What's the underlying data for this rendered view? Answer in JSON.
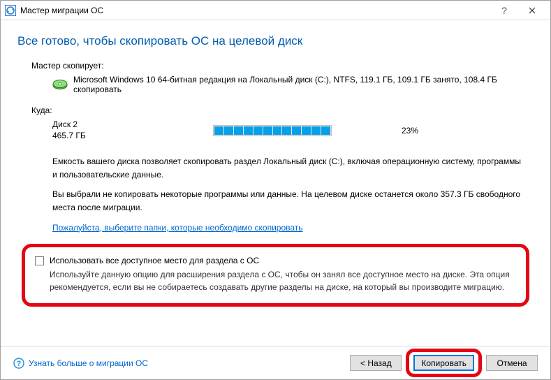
{
  "window": {
    "title": "Мастер миграции ОС"
  },
  "heading": "Все готово, чтобы скопировать ОС на целевой диск",
  "wizard_copies_label": "Мастер скопирует:",
  "source_line": "Microsoft Windows 10 64-битная редакция на Локальный диск (C:), NTFS, 119.1 ГБ, 109.1 ГБ занято, 108.4 ГБ скопировать",
  "dest_label": "Куда:",
  "dest": {
    "disk_name": "Диск 2",
    "disk_size": "465.7 ГБ",
    "progress_pct": "23%"
  },
  "desc1": "Емкость вашего диска позволяет скопировать раздел Локальный диск (C:), включая операционную систему, программы и пользовательские данные.",
  "desc2": "Вы выбрали не копировать некоторые программы или данные. На целевом диске останется около 357.3 ГБ свободного места после миграции.",
  "select_folders_link": "Пожалуйста, выберите папки, которые необходимо скопировать",
  "option": {
    "label": "Использовать все доступное место для раздела с ОС",
    "desc": "Используйте данную опцию для расширения раздела с ОС, чтобы он занял все доступное место на диске. Эта опция рекомендуется, если вы не собираетесь создавать другие разделы на диске, на который вы производите миграцию."
  },
  "footer": {
    "help_link": "Узнать больше о миграции ОС",
    "back": "< Назад",
    "copy": "Копировать",
    "cancel": "Отмена"
  }
}
